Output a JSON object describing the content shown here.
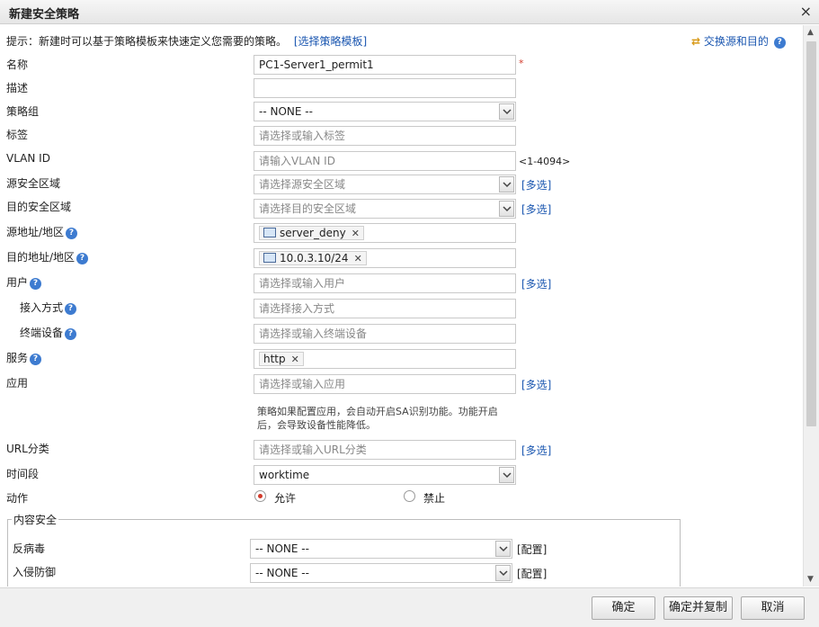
{
  "dialog": {
    "title": "新建安全策略"
  },
  "hint": {
    "text": "提示：新建时可以基于策略模板来快速定义您需要的策略。",
    "template_link": "[选择策略模板]",
    "swap_link": "交换源和目的"
  },
  "form": {
    "name": {
      "label": "名称",
      "value": "PC1-Server1_permit1",
      "required_mark": "*"
    },
    "desc": {
      "label": "描述",
      "value": ""
    },
    "group": {
      "label": "策略组",
      "value": "-- NONE --"
    },
    "tag": {
      "label": "标签",
      "placeholder": "请选择或输入标签"
    },
    "vlan": {
      "label": "VLAN ID",
      "placeholder": "请输入VLAN ID",
      "range": "<1-4094>"
    },
    "src_zone": {
      "label": "源安全区域",
      "placeholder": "请选择源安全区域",
      "multi": "[多选]"
    },
    "dst_zone": {
      "label": "目的安全区域",
      "placeholder": "请选择目的安全区域",
      "multi": "[多选]"
    },
    "src_addr": {
      "label": "源地址/地区",
      "tag": "server_deny"
    },
    "dst_addr": {
      "label": "目的地址/地区",
      "tag": "10.0.3.10/24"
    },
    "user": {
      "label": "用户",
      "placeholder": "请选择或输入用户",
      "multi": "[多选]"
    },
    "access": {
      "label": "接入方式",
      "placeholder": "请选择接入方式"
    },
    "terminal": {
      "label": "终端设备",
      "placeholder": "请选择或输入终端设备"
    },
    "service": {
      "label": "服务",
      "tag": "http"
    },
    "app": {
      "label": "应用",
      "placeholder": "请选择或输入应用",
      "multi": "[多选]",
      "note_line1": "策略如果配置应用，会自动开启SA识别功能。功能开启",
      "note_line2": "后，会导致设备性能降低。"
    },
    "url": {
      "label": "URL分类",
      "placeholder": "请选择或输入URL分类",
      "multi": "[多选]"
    },
    "time": {
      "label": "时间段",
      "value": "worktime"
    },
    "action": {
      "label": "动作",
      "allow": "允许",
      "deny": "禁止",
      "selected": "允许"
    }
  },
  "content_security": {
    "legend": "内容安全",
    "antivirus": {
      "label": "反病毒",
      "value": "-- NONE --",
      "config": "[配置]"
    },
    "ips": {
      "label": "入侵防御",
      "value": "-- NONE --",
      "config": "[配置]"
    }
  },
  "footer": {
    "ok": "确定",
    "ok_copy": "确定并复制",
    "cancel": "取消"
  }
}
